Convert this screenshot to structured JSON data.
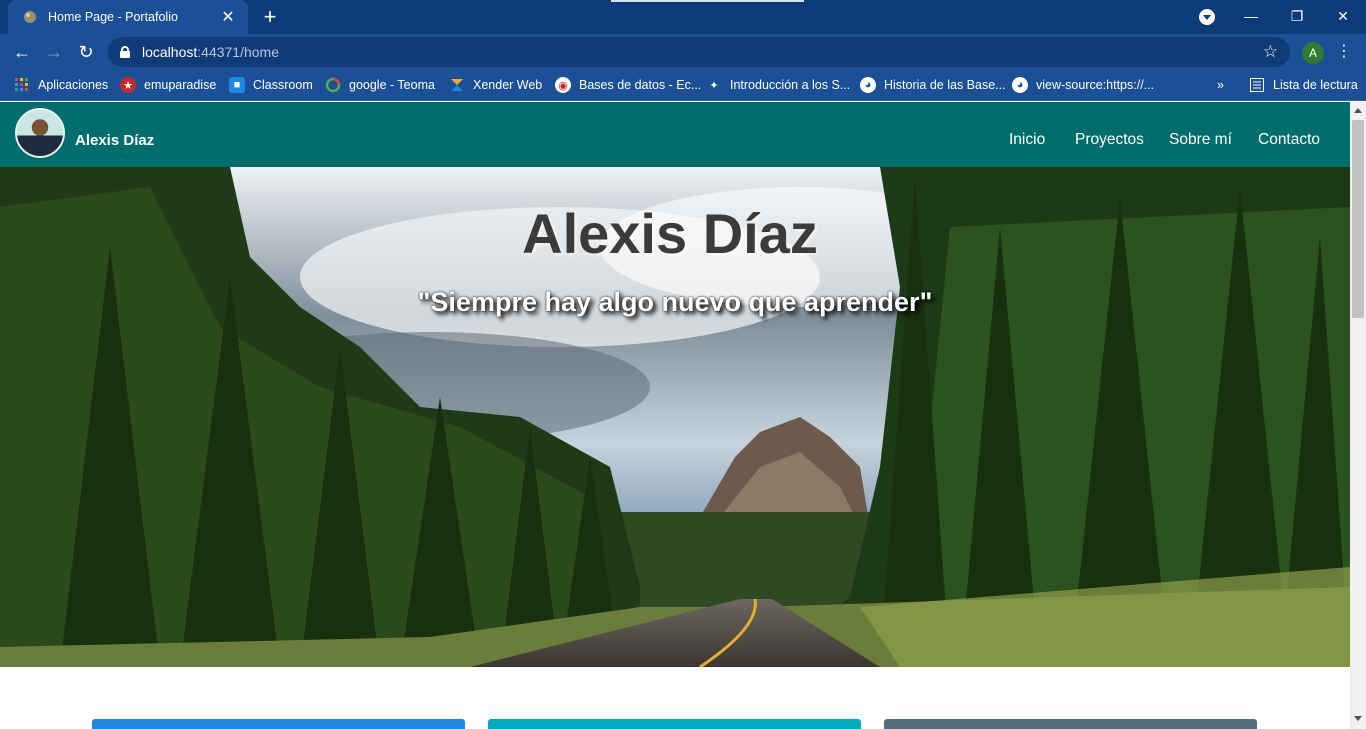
{
  "browser": {
    "tab_title": "Home Page - Portafolio",
    "tab_close": "✕",
    "new_tab": "+",
    "url_host": "localhost",
    "url_rest": ":44371/home",
    "profile_initial": "A",
    "window": {
      "minimize": "—",
      "restore": "❐",
      "close": "✕"
    },
    "bookmarks": [
      {
        "label": "Aplicaciones",
        "icon": "apps-grid-icon"
      },
      {
        "label": "emuparadise",
        "icon": "emuparadise-icon"
      },
      {
        "label": "Classroom",
        "icon": "classroom-icon"
      },
      {
        "label": "google - Teoma",
        "icon": "google-icon"
      },
      {
        "label": "Xender Web",
        "icon": "xender-icon"
      },
      {
        "label": "Bases de datos - Ec...",
        "icon": "database-site-icon"
      },
      {
        "label": "Introducción a los S...",
        "icon": "site-icon"
      },
      {
        "label": "Historia de las Base...",
        "icon": "globe-icon"
      },
      {
        "label": "view-source:https://...",
        "icon": "globe-icon"
      }
    ],
    "bookmarks_overflow": "»",
    "reading_list": "Lista de lectura"
  },
  "page": {
    "brand_name": "Alexis Díaz",
    "nav": [
      "Inicio",
      "Proyectos",
      "Sobre mí",
      "Contacto"
    ],
    "hero_title": "Alexis Díaz",
    "hero_quote": "\"Siempre hay algo nuevo que aprender\"",
    "card_colors": [
      "#1e88e5",
      "#00acc1",
      "#546e7a"
    ]
  }
}
